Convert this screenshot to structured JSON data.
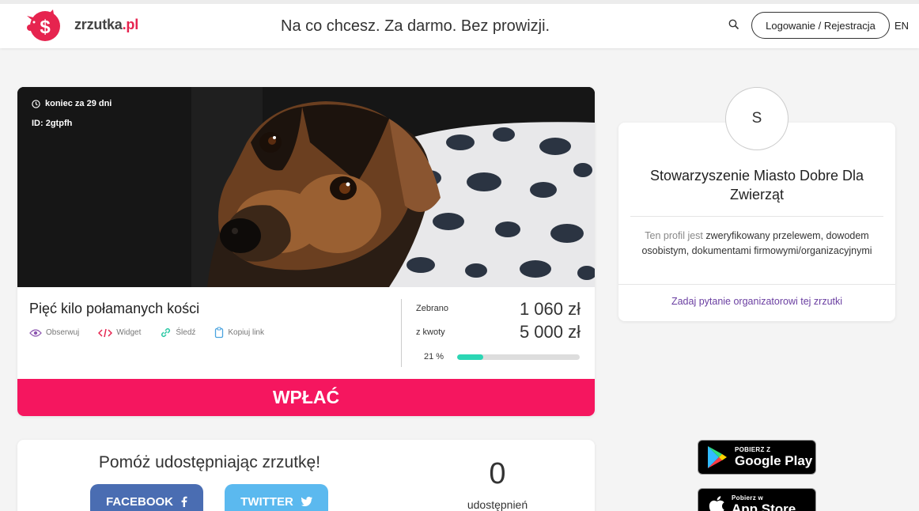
{
  "brand": {
    "name": "zrzutka",
    "tld": ".pl",
    "accent": "#e6244f"
  },
  "header": {
    "tagline": "Na co chcesz. Za darmo. Bez prowizji.",
    "login_label": "Logowanie / Rejestracja",
    "lang": "EN",
    "search_icon": "search-icon"
  },
  "campaign": {
    "deadline": "koniec za 29 dni",
    "id": "ID: 2gtpfh",
    "title": "Pięć kilo połamanych kości",
    "actions": [
      {
        "label": "Obserwuj",
        "icon": "eye-icon"
      },
      {
        "label": "Widget",
        "icon": "code-icon"
      },
      {
        "label": "Śledź",
        "icon": "link-icon"
      },
      {
        "label": "Kopiuj link",
        "icon": "clipboard-icon"
      }
    ],
    "raised_label": "Zebrano",
    "raised_value": "1 060 zł",
    "goal_label": "z kwoty",
    "goal_value": "5 000 zł",
    "percent_label": "21 %",
    "progress_fraction": 0.21,
    "progress_color": "#2bd6b4",
    "donate_label": "WPŁAĆ",
    "donate_color": "#f5165f"
  },
  "organizer": {
    "avatar_letter": "S",
    "name": "Stowarzyszenie Miasto Dobre Dla Zwierząt",
    "verified_prefix": "Ten profil jest",
    "verified_text": "zweryfikowany przelewem, dowodem osobistym, dokumentami firmowymi/organizacyjnymi",
    "ask_link": "Zadaj pytanie organizatorowi tej zrzutki"
  },
  "share": {
    "title": "Pomóż udostępniając zrzutkę!",
    "facebook_label": "FACEBOOK",
    "twitter_label": "TWITTER",
    "count": "0",
    "count_label": "udostępnień"
  },
  "stores": {
    "google": {
      "small": "POBIERZ Z",
      "big": "Google Play"
    },
    "apple": {
      "small": "Pobierz w",
      "big": "App Store"
    }
  }
}
